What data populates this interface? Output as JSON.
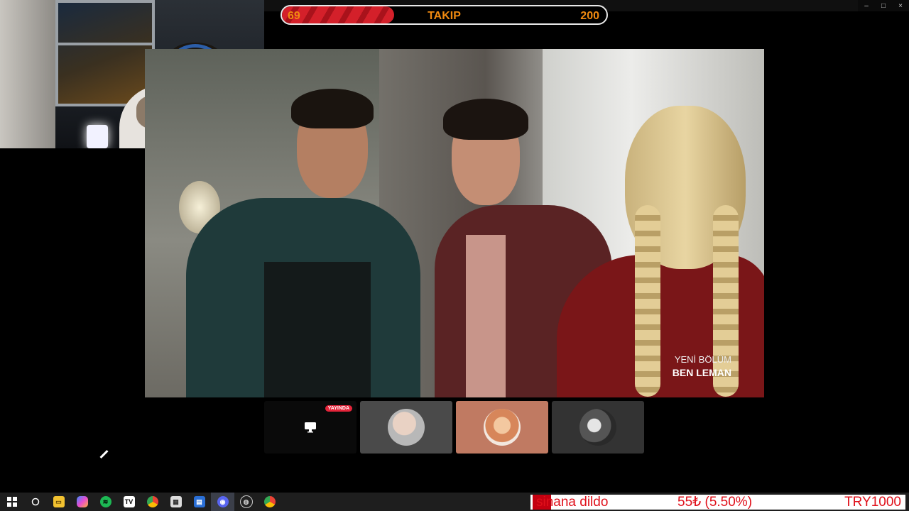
{
  "window": {
    "controls": [
      "–",
      "□",
      "×"
    ]
  },
  "goal": {
    "current": "69",
    "title": "TAKIP",
    "target": "200",
    "progress": 0.345
  },
  "video": {
    "caption_sub": "YENİ BÖLÜM",
    "caption": "BEN LEMAN"
  },
  "tiles": [
    {
      "name": "screen-share",
      "badge": "YAYINDA",
      "icon": "monitor-icon"
    },
    {
      "name": "participant-1"
    },
    {
      "name": "participant-2",
      "highlighted": true
    },
    {
      "name": "participant-3"
    }
  ],
  "taskbar": {
    "icons": [
      "windows-start-icon",
      "search-circle-icon",
      "file-explorer-icon",
      "copilot-icon",
      "spotify-icon",
      "tradingview-icon",
      "chrome-icon",
      "store-icon",
      "app-icon",
      "discord-icon",
      "obs-icon",
      "chrome-profile-icon"
    ]
  },
  "ticker": {
    "name": "sinana dildo",
    "amount": "55₺ (5.50%)",
    "goal": "TRY1000"
  },
  "colors": {
    "goal_fill": "#d4202a",
    "goal_text": "#f08a10",
    "ticker_text": "#e0101a",
    "live_badge": "#e5243a"
  }
}
